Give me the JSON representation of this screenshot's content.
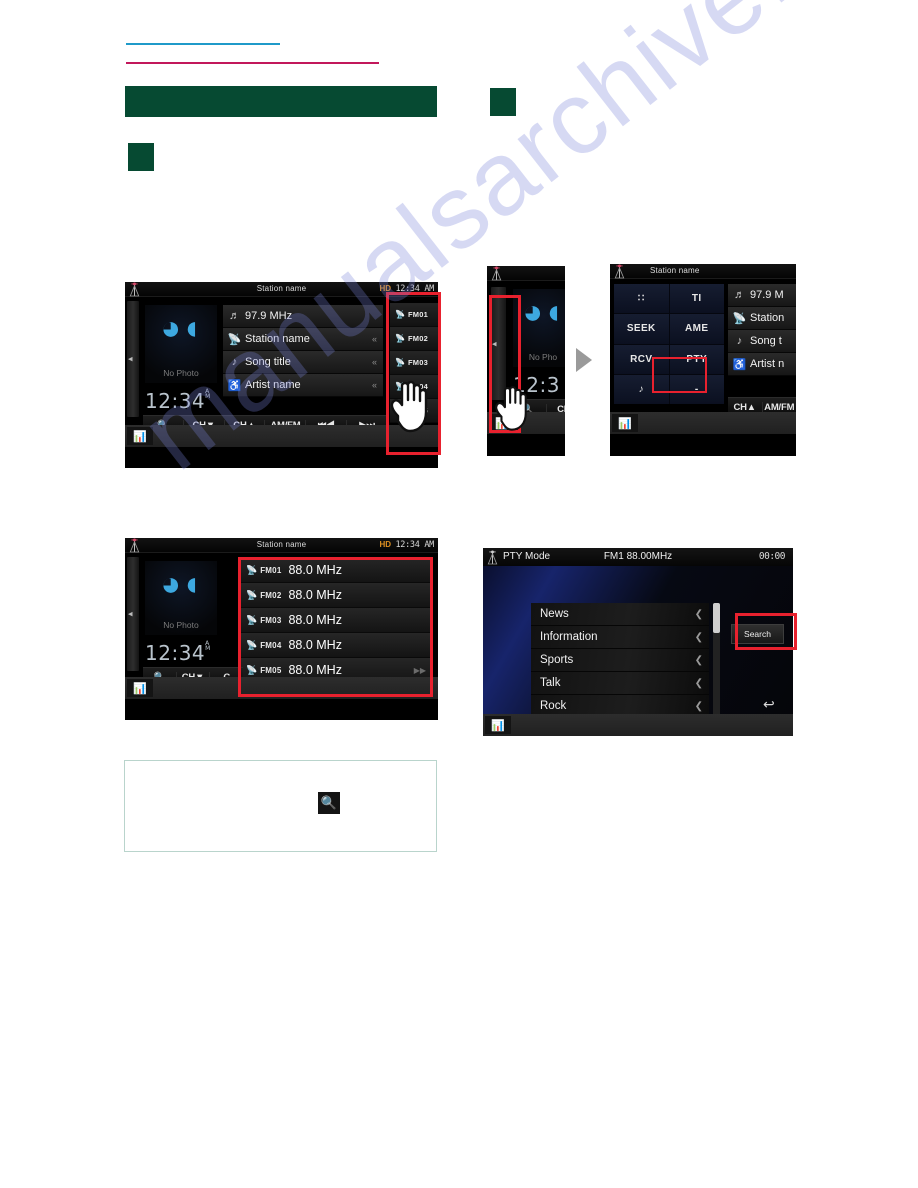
{
  "page": {
    "watermark": "manualsarchive.c",
    "accent_green": "#064a32",
    "accent_green_light": "#cfe3d8",
    "rule_blue": "#1f9ac9",
    "rule_red": "#c2185b",
    "callout_red": "#e8212e"
  },
  "panel1": {
    "header": {
      "title": "Station name",
      "hd_badge": "HD",
      "clock": "12:34 AM",
      "antenna_icon": "antenna-icon"
    },
    "artwork": {
      "placeholder": "No Photo",
      "wave_icon": "radio-wave-icon"
    },
    "clock_big": {
      "time": "12:34",
      "ampm_top": "A",
      "ampm_bottom": "M"
    },
    "info_rows": [
      {
        "icon": "frequency-icon",
        "text": "97.9 MHz",
        "scroll": ""
      },
      {
        "icon": "station-icon",
        "text": "Station name",
        "scroll": "«"
      },
      {
        "icon": "song-icon",
        "text": "Song title",
        "scroll": "«"
      },
      {
        "icon": "artist-icon",
        "text": "Artist name",
        "scroll": "«"
      }
    ],
    "presets": [
      "FM01",
      "FM02",
      "FM03",
      "FM04",
      "FM05"
    ],
    "controls": [
      "🔍",
      "CH▼",
      "CH▲",
      "AM/FM",
      "⏮◀",
      "▶⏭"
    ],
    "eq_badge": "equalizer-icon"
  },
  "panel2a": {
    "rail": "side-rail-handle",
    "artwork_placeholder": "No Pho",
    "clock_partial": "12:3",
    "controls": [
      "🔍",
      "CH"
    ],
    "eq_badge": "equalizer-icon"
  },
  "panel2b": {
    "header": {
      "title": "Station name",
      "antenna_icon": "antenna-icon"
    },
    "function_buttons": [
      "∷",
      "TI",
      "SEEK",
      "AME",
      "RCV",
      "PTY",
      "♪",
      "-"
    ],
    "info_rows": [
      {
        "icon": "frequency-icon",
        "text": "97.9 M"
      },
      {
        "icon": "station-icon",
        "text": "Station"
      },
      {
        "icon": "song-icon",
        "text": "Song t"
      },
      {
        "icon": "artist-icon",
        "text": "Artist n"
      }
    ],
    "controls": [
      "CH▲",
      "AM/FM"
    ],
    "highlight": "PTY",
    "eq_badge": "equalizer-icon"
  },
  "panel3": {
    "header": {
      "title": "Station name",
      "hd_badge": "HD",
      "clock": "12:34 AM",
      "antenna_icon": "antenna-icon"
    },
    "artwork": {
      "placeholder": "No Photo",
      "wave_icon": "radio-wave-icon"
    },
    "clock_big": {
      "time": "12:34",
      "ampm_top": "A",
      "ampm_bottom": "M"
    },
    "preset_rows": [
      {
        "label": "FM01",
        "freq": "88.0 MHz"
      },
      {
        "label": "FM02",
        "freq": "88.0 MHz"
      },
      {
        "label": "FM03",
        "freq": "88.0 MHz"
      },
      {
        "label": "FM04",
        "freq": "88.0 MHz"
      },
      {
        "label": "FM05",
        "freq": "88.0 MHz"
      }
    ],
    "controls": [
      "🔍",
      "CH▼",
      "C"
    ],
    "eq_badge": "equalizer-icon"
  },
  "panel4": {
    "header": {
      "title": "PTY Mode",
      "frequency": "FM1 88.00MHz",
      "clock": "00:00",
      "antenna_icon": "antenna-icon"
    },
    "pty_items": [
      "News",
      "Information",
      "Sports",
      "Talk",
      "Rock"
    ],
    "search_button": "Search",
    "back_icon": "back-arrow-icon",
    "eq_badge": "equalizer-icon"
  },
  "note": {
    "icon": "search-icon",
    "icon_glyph": "🔍"
  }
}
